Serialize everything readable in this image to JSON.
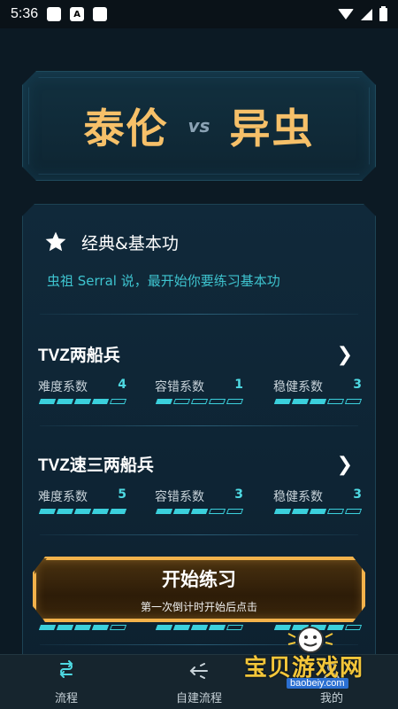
{
  "status_bar": {
    "time": "5:36",
    "notif_icons": [
      "square-icon",
      "a-icon",
      "square-icon"
    ]
  },
  "header": {
    "race_left": "泰伦",
    "vs": "vs",
    "race_right": "异虫"
  },
  "category": {
    "title": "经典&基本功",
    "description": "虫祖 Serral 说，最开始你要练习基本功"
  },
  "drills": [
    {
      "name": "TVZ两船兵",
      "metrics": [
        {
          "label": "难度系数",
          "value": "4",
          "level": 4
        },
        {
          "label": "容错系数",
          "value": "1",
          "level": 1
        },
        {
          "label": "稳健系数",
          "value": "3",
          "level": 3
        }
      ]
    },
    {
      "name": "TVZ速三两船兵",
      "metrics": [
        {
          "label": "难度系数",
          "value": "5",
          "level": 5
        },
        {
          "label": "容错系数",
          "value": "3",
          "level": 3
        },
        {
          "label": "稳健系数",
          "value": "3",
          "level": 3
        }
      ]
    }
  ],
  "third_drill_bar_levels": [
    4,
    4,
    4
  ],
  "start_button": {
    "label": "开始练习",
    "sub": "第一次倒计时开始后点击"
  },
  "nav": [
    {
      "label": "流程",
      "icon": "flow-icon"
    },
    {
      "label": "自建流程",
      "icon": "custom-flow-icon"
    },
    {
      "label": "我的",
      "icon": "profile-icon"
    }
  ],
  "watermark": {
    "text": "宝贝游戏网",
    "url": "baobeiy.com"
  },
  "colors": {
    "accent": "#3ec4cf",
    "gold": "#f6c069",
    "button_border": "#f2b24b",
    "background": "#0c1a24"
  }
}
